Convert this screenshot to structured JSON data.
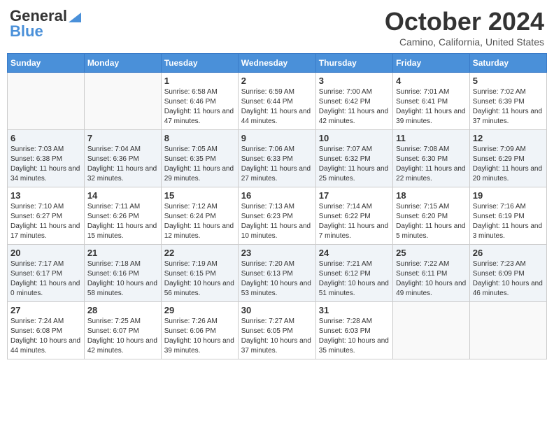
{
  "header": {
    "logo_line1": "General",
    "logo_line2": "Blue",
    "month": "October 2024",
    "location": "Camino, California, United States"
  },
  "days_of_week": [
    "Sunday",
    "Monday",
    "Tuesday",
    "Wednesday",
    "Thursday",
    "Friday",
    "Saturday"
  ],
  "weeks": [
    [
      {
        "day": "",
        "sunrise": "",
        "sunset": "",
        "daylight": ""
      },
      {
        "day": "",
        "sunrise": "",
        "sunset": "",
        "daylight": ""
      },
      {
        "day": "1",
        "sunrise": "Sunrise: 6:58 AM",
        "sunset": "Sunset: 6:46 PM",
        "daylight": "Daylight: 11 hours and 47 minutes."
      },
      {
        "day": "2",
        "sunrise": "Sunrise: 6:59 AM",
        "sunset": "Sunset: 6:44 PM",
        "daylight": "Daylight: 11 hours and 44 minutes."
      },
      {
        "day": "3",
        "sunrise": "Sunrise: 7:00 AM",
        "sunset": "Sunset: 6:42 PM",
        "daylight": "Daylight: 11 hours and 42 minutes."
      },
      {
        "day": "4",
        "sunrise": "Sunrise: 7:01 AM",
        "sunset": "Sunset: 6:41 PM",
        "daylight": "Daylight: 11 hours and 39 minutes."
      },
      {
        "day": "5",
        "sunrise": "Sunrise: 7:02 AM",
        "sunset": "Sunset: 6:39 PM",
        "daylight": "Daylight: 11 hours and 37 minutes."
      }
    ],
    [
      {
        "day": "6",
        "sunrise": "Sunrise: 7:03 AM",
        "sunset": "Sunset: 6:38 PM",
        "daylight": "Daylight: 11 hours and 34 minutes."
      },
      {
        "day": "7",
        "sunrise": "Sunrise: 7:04 AM",
        "sunset": "Sunset: 6:36 PM",
        "daylight": "Daylight: 11 hours and 32 minutes."
      },
      {
        "day": "8",
        "sunrise": "Sunrise: 7:05 AM",
        "sunset": "Sunset: 6:35 PM",
        "daylight": "Daylight: 11 hours and 29 minutes."
      },
      {
        "day": "9",
        "sunrise": "Sunrise: 7:06 AM",
        "sunset": "Sunset: 6:33 PM",
        "daylight": "Daylight: 11 hours and 27 minutes."
      },
      {
        "day": "10",
        "sunrise": "Sunrise: 7:07 AM",
        "sunset": "Sunset: 6:32 PM",
        "daylight": "Daylight: 11 hours and 25 minutes."
      },
      {
        "day": "11",
        "sunrise": "Sunrise: 7:08 AM",
        "sunset": "Sunset: 6:30 PM",
        "daylight": "Daylight: 11 hours and 22 minutes."
      },
      {
        "day": "12",
        "sunrise": "Sunrise: 7:09 AM",
        "sunset": "Sunset: 6:29 PM",
        "daylight": "Daylight: 11 hours and 20 minutes."
      }
    ],
    [
      {
        "day": "13",
        "sunrise": "Sunrise: 7:10 AM",
        "sunset": "Sunset: 6:27 PM",
        "daylight": "Daylight: 11 hours and 17 minutes."
      },
      {
        "day": "14",
        "sunrise": "Sunrise: 7:11 AM",
        "sunset": "Sunset: 6:26 PM",
        "daylight": "Daylight: 11 hours and 15 minutes."
      },
      {
        "day": "15",
        "sunrise": "Sunrise: 7:12 AM",
        "sunset": "Sunset: 6:24 PM",
        "daylight": "Daylight: 11 hours and 12 minutes."
      },
      {
        "day": "16",
        "sunrise": "Sunrise: 7:13 AM",
        "sunset": "Sunset: 6:23 PM",
        "daylight": "Daylight: 11 hours and 10 minutes."
      },
      {
        "day": "17",
        "sunrise": "Sunrise: 7:14 AM",
        "sunset": "Sunset: 6:22 PM",
        "daylight": "Daylight: 11 hours and 7 minutes."
      },
      {
        "day": "18",
        "sunrise": "Sunrise: 7:15 AM",
        "sunset": "Sunset: 6:20 PM",
        "daylight": "Daylight: 11 hours and 5 minutes."
      },
      {
        "day": "19",
        "sunrise": "Sunrise: 7:16 AM",
        "sunset": "Sunset: 6:19 PM",
        "daylight": "Daylight: 11 hours and 3 minutes."
      }
    ],
    [
      {
        "day": "20",
        "sunrise": "Sunrise: 7:17 AM",
        "sunset": "Sunset: 6:17 PM",
        "daylight": "Daylight: 11 hours and 0 minutes."
      },
      {
        "day": "21",
        "sunrise": "Sunrise: 7:18 AM",
        "sunset": "Sunset: 6:16 PM",
        "daylight": "Daylight: 10 hours and 58 minutes."
      },
      {
        "day": "22",
        "sunrise": "Sunrise: 7:19 AM",
        "sunset": "Sunset: 6:15 PM",
        "daylight": "Daylight: 10 hours and 56 minutes."
      },
      {
        "day": "23",
        "sunrise": "Sunrise: 7:20 AM",
        "sunset": "Sunset: 6:13 PM",
        "daylight": "Daylight: 10 hours and 53 minutes."
      },
      {
        "day": "24",
        "sunrise": "Sunrise: 7:21 AM",
        "sunset": "Sunset: 6:12 PM",
        "daylight": "Daylight: 10 hours and 51 minutes."
      },
      {
        "day": "25",
        "sunrise": "Sunrise: 7:22 AM",
        "sunset": "Sunset: 6:11 PM",
        "daylight": "Daylight: 10 hours and 49 minutes."
      },
      {
        "day": "26",
        "sunrise": "Sunrise: 7:23 AM",
        "sunset": "Sunset: 6:09 PM",
        "daylight": "Daylight: 10 hours and 46 minutes."
      }
    ],
    [
      {
        "day": "27",
        "sunrise": "Sunrise: 7:24 AM",
        "sunset": "Sunset: 6:08 PM",
        "daylight": "Daylight: 10 hours and 44 minutes."
      },
      {
        "day": "28",
        "sunrise": "Sunrise: 7:25 AM",
        "sunset": "Sunset: 6:07 PM",
        "daylight": "Daylight: 10 hours and 42 minutes."
      },
      {
        "day": "29",
        "sunrise": "Sunrise: 7:26 AM",
        "sunset": "Sunset: 6:06 PM",
        "daylight": "Daylight: 10 hours and 39 minutes."
      },
      {
        "day": "30",
        "sunrise": "Sunrise: 7:27 AM",
        "sunset": "Sunset: 6:05 PM",
        "daylight": "Daylight: 10 hours and 37 minutes."
      },
      {
        "day": "31",
        "sunrise": "Sunrise: 7:28 AM",
        "sunset": "Sunset: 6:03 PM",
        "daylight": "Daylight: 10 hours and 35 minutes."
      },
      {
        "day": "",
        "sunrise": "",
        "sunset": "",
        "daylight": ""
      },
      {
        "day": "",
        "sunrise": "",
        "sunset": "",
        "daylight": ""
      }
    ]
  ]
}
